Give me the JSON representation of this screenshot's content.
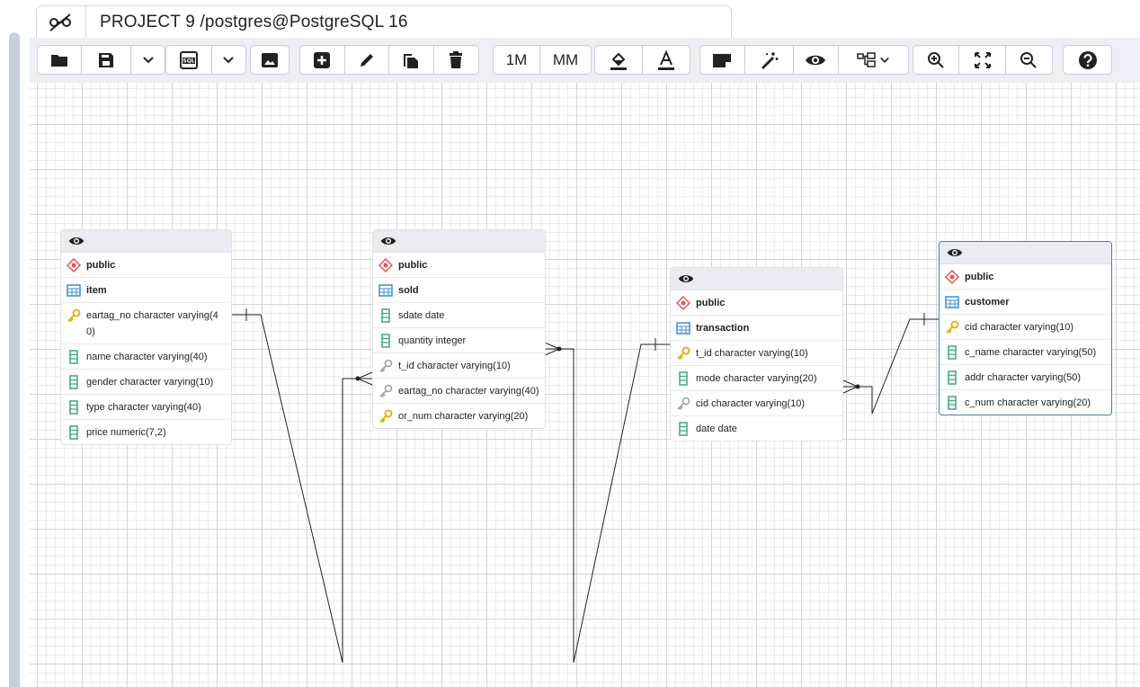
{
  "tab": {
    "title": "PROJECT 9 /postgres@PostgreSQL 16"
  },
  "toolbar": {
    "one_to_many_label": "1M",
    "many_to_many_label": "MM",
    "buttons": [
      "open-file-icon",
      "save-icon",
      "chevron-down-icon",
      "sql-icon",
      "chevron-down-icon",
      "image-icon",
      "add-table-icon",
      "edit-icon",
      "clone-icon",
      "delete-icon",
      "1M",
      "MM",
      "fill-color-icon",
      "text-color-icon",
      "note-icon",
      "auto-align-icon",
      "eye-icon",
      "details-icon",
      "zoom-in-icon",
      "zoom-fit-icon",
      "zoom-out-icon",
      "help-icon"
    ]
  },
  "entities": {
    "item": {
      "schema": "public",
      "table": "item",
      "columns": [
        {
          "text": "eartag_no character varying(40)",
          "type": "pk"
        },
        {
          "text": "name character varying(40)",
          "type": "col"
        },
        {
          "text": "gender character varying(10)",
          "type": "col"
        },
        {
          "text": "type character varying(40)",
          "type": "col"
        },
        {
          "text": "price numeric(7,2)",
          "type": "col"
        }
      ]
    },
    "sold": {
      "schema": "public",
      "table": "sold",
      "columns": [
        {
          "text": "sdate date",
          "type": "col"
        },
        {
          "text": "quantity integer",
          "type": "col"
        },
        {
          "text": "t_id character varying(10)",
          "type": "fk"
        },
        {
          "text": "eartag_no character varying(40)",
          "type": "fk"
        },
        {
          "text": "or_num character varying(20)",
          "type": "pk"
        }
      ]
    },
    "transaction": {
      "schema": "public",
      "table": "transaction",
      "columns": [
        {
          "text": "t_id character varying(10)",
          "type": "pk"
        },
        {
          "text": "mode character varying(20)",
          "type": "col"
        },
        {
          "text": "cid character varying(10)",
          "type": "fk"
        },
        {
          "text": "date date",
          "type": "col"
        }
      ]
    },
    "customer": {
      "schema": "public",
      "table": "customer",
      "columns": [
        {
          "text": "cid character varying(10)",
          "type": "pk"
        },
        {
          "text": "c_name character varying(50)",
          "type": "col"
        },
        {
          "text": "addr character varying(50)",
          "type": "col"
        },
        {
          "text": "c_num character varying(20)",
          "type": "col"
        }
      ]
    }
  },
  "colors": {
    "pk_key": "#e0b31a",
    "fk_key": "#9aa1a8",
    "column": "#3aa77a",
    "table": "#3b8fd6",
    "schema": "#e25555",
    "selected_border": "#4a7fae"
  }
}
